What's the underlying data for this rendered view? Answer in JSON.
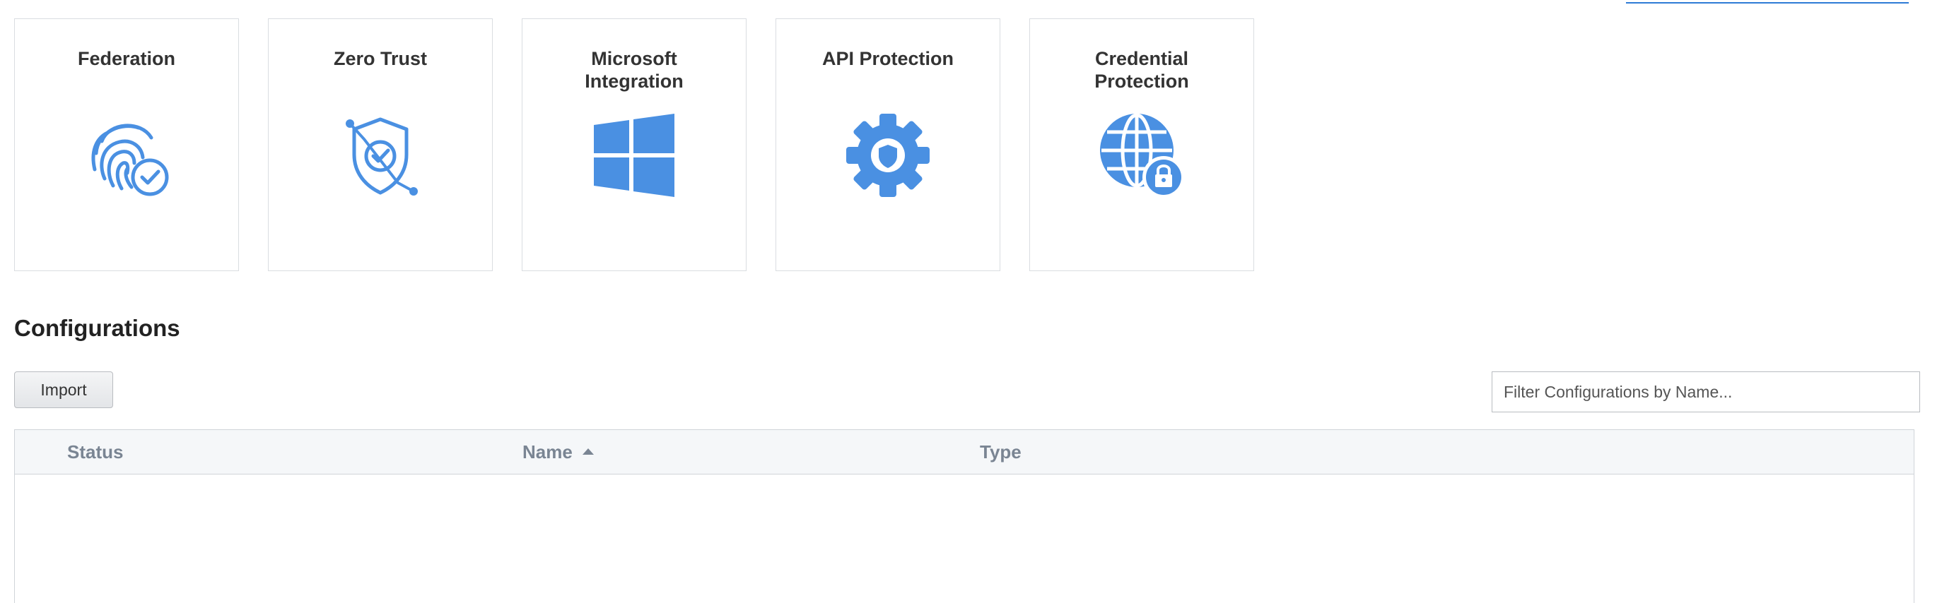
{
  "cards": [
    {
      "title": "Federation",
      "icon": "fingerprint-check-icon"
    },
    {
      "title": "Zero Trust",
      "icon": "shield-check-icon"
    },
    {
      "title": "Microsoft Integration",
      "icon": "windows-logo-icon"
    },
    {
      "title": "API Protection",
      "icon": "gear-shield-icon"
    },
    {
      "title": "Credential Protection",
      "icon": "globe-lock-icon"
    }
  ],
  "configurations": {
    "title": "Configurations",
    "import_label": "Import",
    "filter_placeholder": "Filter Configurations by Name...",
    "columns": {
      "status": "Status",
      "name": "Name",
      "type": "Type"
    },
    "sort": {
      "column": "Name",
      "direction": "ascending"
    },
    "rows": []
  },
  "colors": {
    "icon_blue": "#4a90e2",
    "card_border": "#dadde1",
    "header_text": "#7a8593"
  }
}
